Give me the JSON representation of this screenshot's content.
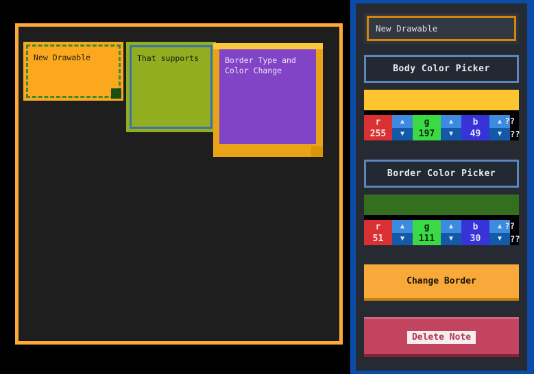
{
  "canvas": {
    "notes": [
      {
        "id": "note-1",
        "text": "New Drawable",
        "body_color": "#FBA81E",
        "border_color": "#3C8A33",
        "border_style": "dashed",
        "handle_color": "#195012",
        "selected": false
      },
      {
        "id": "note-2",
        "text": "That supports",
        "body_color": "#92AD20",
        "border_color": "#3C72AC",
        "border_style": "solid",
        "handle_color": "",
        "selected": false
      },
      {
        "id": "note-3",
        "text": "Border Type and\nColor Change",
        "body_color": "#8244C6",
        "border_color": "#E8A317",
        "border_style": "solid",
        "handle_color": "#DD940C",
        "selected": true
      }
    ],
    "board_border_color": "#FCA936",
    "board_background": "#1e1e1e"
  },
  "sidebar": {
    "accent_border": "#0B4CA8",
    "panel_background": "#262B33",
    "title": {
      "value": "New Drawable",
      "placeholder": "New Drawable",
      "border_color": "#D4870F"
    },
    "body_picker": {
      "label": "Body Color Picker",
      "swatch_color": "#FFC531",
      "channels": [
        {
          "name": "r",
          "value": "255"
        },
        {
          "name": "g",
          "value": "197"
        },
        {
          "name": "b",
          "value": "49"
        }
      ],
      "spinner_up": "▲",
      "spinner_down": "▼",
      "extra_top": "??",
      "extra_bottom": "??"
    },
    "border_picker": {
      "label": "Border Color Picker",
      "swatch_color": "#336F1E",
      "channels": [
        {
          "name": "r",
          "value": "51"
        },
        {
          "name": "g",
          "value": "111"
        },
        {
          "name": "b",
          "value": "30"
        }
      ],
      "spinner_up": "▲",
      "spinner_down": "▼",
      "extra_top": "??",
      "extra_bottom": "??"
    },
    "change_border_label": "Change Border",
    "delete_note_label": "Delete Note"
  }
}
